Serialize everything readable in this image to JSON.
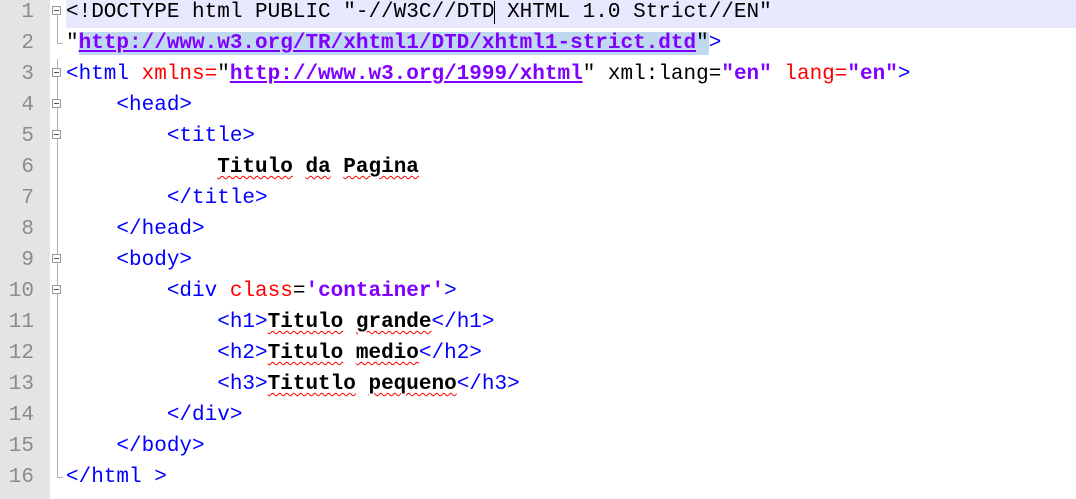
{
  "editor": {
    "language": "HTML",
    "line_numbers": [
      "1",
      "2",
      "3",
      "4",
      "5",
      "6",
      "7",
      "8",
      "9",
      "10",
      "11",
      "12",
      "13",
      "14",
      "15",
      "16"
    ],
    "lines": [
      {
        "text": "<!DOCTYPE html PUBLIC \"-//W3C//DTD XHTML 1.0 Strict//EN\""
      },
      {
        "text": "\"http://www.w3.org/TR/xhtml1/DTD/xhtml1-strict.dtd\">"
      },
      {
        "text": "<html xmlns=\"http://www.w3.org/1999/xhtml\" xml:lang=\"en\" lang=\"en\">"
      },
      {
        "text": "    <head>"
      },
      {
        "text": "        <title>"
      },
      {
        "text": "            Titulo da Pagina"
      },
      {
        "text": "        </title>"
      },
      {
        "text": "    </head>"
      },
      {
        "text": "    <body>"
      },
      {
        "text": "        <div class='container'>"
      },
      {
        "text": "            <h1>Titulo grande</h1>"
      },
      {
        "text": "            <h2>Titulo medio</h2>"
      },
      {
        "text": "            <h3>Titutlo pequeno</h3>"
      },
      {
        "text": "        </div>"
      },
      {
        "text": "    </body>"
      },
      {
        "text": "</html >"
      }
    ],
    "colors": {
      "gutter_bg": "#e4e4e4",
      "current_line_bg": "#e8e8ff",
      "selection_bg": "#c0d8f0",
      "tag": "#0000ff",
      "attribute": "#ff0000",
      "value": "#8000ff",
      "line_number": "#8b8b8b"
    }
  }
}
